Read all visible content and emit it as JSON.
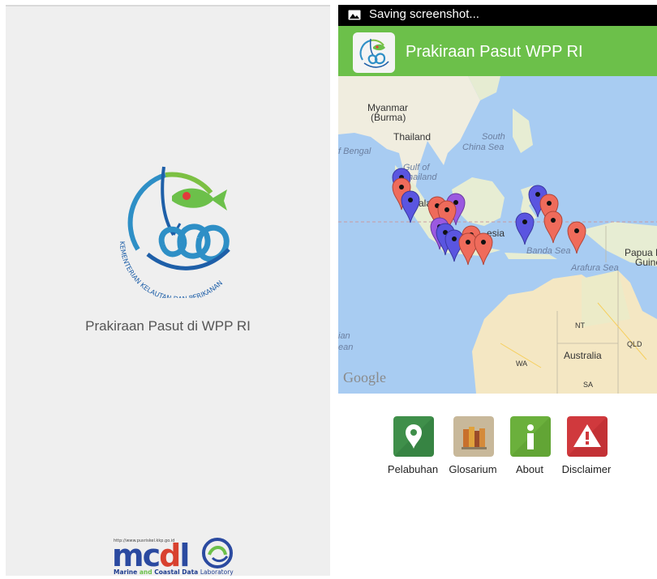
{
  "splash": {
    "logo_text": "KEMENTERIAN KELAUTAN DAN PERIKANAN",
    "title": "Prakiraan Pasut di WPP RI",
    "footer_logo": {
      "url": "http://www.pusriskel.kkp.go.id",
      "wordmark": "mcdl",
      "subtitle_a": "Marine",
      "subtitle_b": "and",
      "subtitle_c": "Coastal",
      "subtitle_d": "Data",
      "subtitle_e": "Laboratory"
    }
  },
  "status_bar": {
    "icon": "image-icon",
    "text": "Saving screenshot..."
  },
  "app_bar": {
    "icon": "kkp-app-icon",
    "title": "Prakiraan Pasut WPP RI",
    "color": "#6cc04a"
  },
  "map": {
    "labels": {
      "myanmar": "Myanmar",
      "burma": "(Burma)",
      "thailand": "Thailand",
      "south_china_sea_a": "South",
      "south_china_sea_b": "China Sea",
      "bengal": "f Bengal",
      "gulf_a": "Gulf of",
      "gulf_b": "hailand",
      "mala": "ala",
      "indonesia": "esia",
      "banda_sea": "Banda Sea",
      "arafura_sea": "Arafura Sea",
      "papua_a": "Papua N",
      "papua_b": "Guine",
      "ocean_a": "ian",
      "ocean_b": "ean",
      "nt": "NT",
      "qld": "QLD",
      "australia": "Australia",
      "wa": "WA",
      "sa": "SA"
    },
    "attribution": "Google",
    "pin_colors": {
      "red": "#ef6b5b",
      "blue": "#5a55e0",
      "purple": "#9b59e0"
    }
  },
  "menu": {
    "items": [
      {
        "label": "Pelabuhan",
        "icon": "map-pin-icon",
        "color": "#3f8f4a"
      },
      {
        "label": "Glosarium",
        "icon": "books-icon",
        "color": "#c8b89a"
      },
      {
        "label": "About",
        "icon": "info-icon",
        "color": "#6bb03c"
      },
      {
        "label": "Disclaimer",
        "icon": "warning-icon",
        "color": "#d0393d"
      }
    ]
  }
}
